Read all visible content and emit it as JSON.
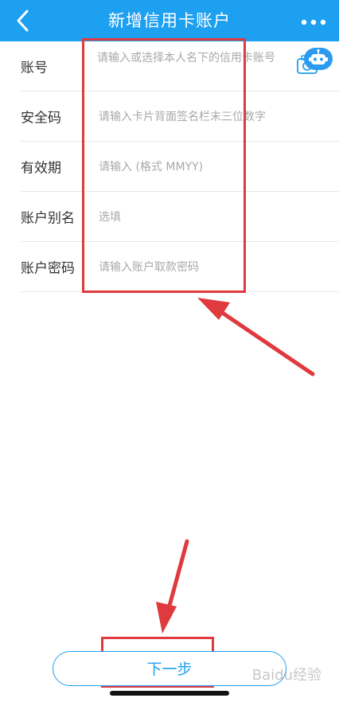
{
  "header": {
    "title": "新增信用卡账户",
    "back_icon": "chevron-left-icon",
    "more_icon": "more-dots-icon"
  },
  "form": {
    "rows": [
      {
        "label": "账号",
        "placeholder": "请输入或选择本人名下的信用卡账号"
      },
      {
        "label": "安全码",
        "placeholder": "请输入卡片背面签名栏末三位数字"
      },
      {
        "label": "有效期",
        "placeholder": "请输入 (格式 MMYY)"
      },
      {
        "label": "账户别名",
        "placeholder": "选填"
      },
      {
        "label": "账户密码",
        "placeholder": "请输入账户取款密码"
      }
    ],
    "camera_icon": "camera-icon",
    "robot_icon": "robot-icon"
  },
  "footer": {
    "next_label": "下一步"
  },
  "watermark": "Baidu经验",
  "colors": {
    "header_bg": "#1ea0f0",
    "accent": "#1ea0f0",
    "annotation": "#e0393e"
  }
}
